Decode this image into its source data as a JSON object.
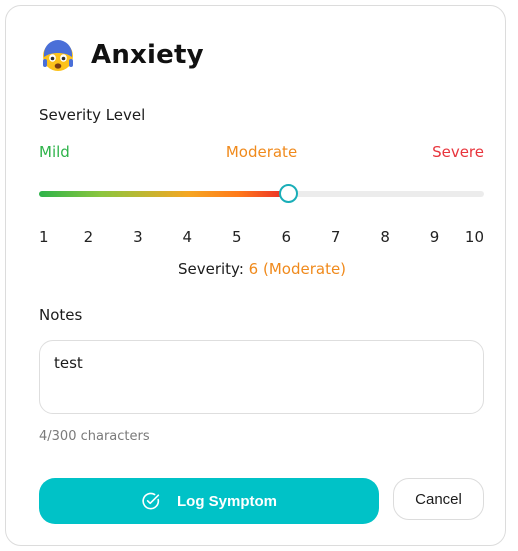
{
  "symptom": {
    "name": "Anxiety",
    "icon": "fearful-face-emoji-icon"
  },
  "severity": {
    "section_label": "Severity Level",
    "scale_words": {
      "mild": "Mild",
      "moderate": "Moderate",
      "severe": "Severe"
    },
    "ticks": [
      "1",
      "2",
      "3",
      "4",
      "5",
      "6",
      "7",
      "8",
      "9",
      "10"
    ],
    "min": 1,
    "max": 10,
    "value": 6,
    "summary_prefix": "Severity:",
    "summary_value": "6 (Moderate)",
    "colors": {
      "mild": "#2eb34a",
      "moderate": "#f08a1c",
      "severe": "#e8343c",
      "thumb_border": "#1aaeb8"
    }
  },
  "notes": {
    "section_label": "Notes",
    "value": "test",
    "char_count": "4/300 characters"
  },
  "actions": {
    "log_label": "Log Symptom",
    "log_icon": "check-circle-icon",
    "cancel_label": "Cancel",
    "accent_color": "#00c2c7"
  }
}
